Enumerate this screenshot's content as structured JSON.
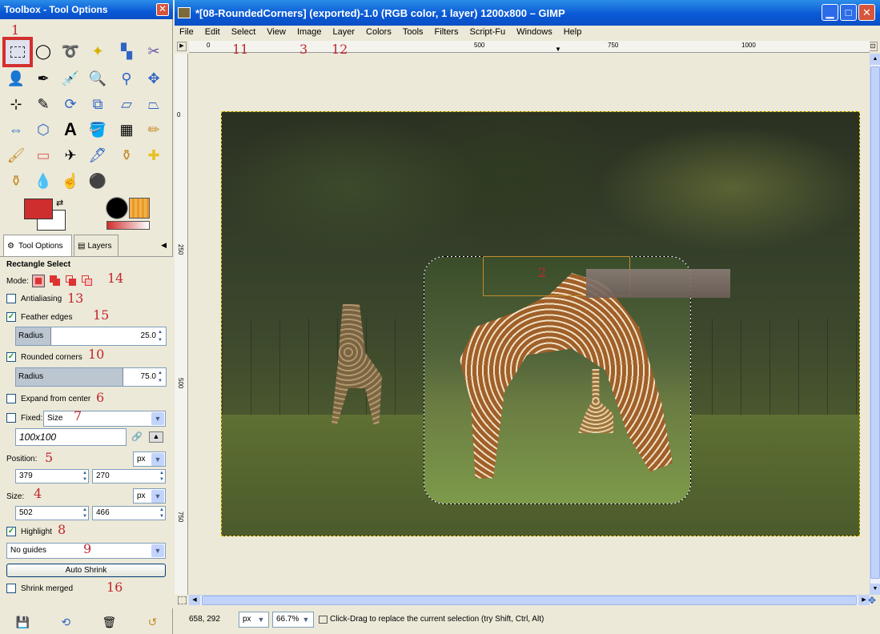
{
  "toolbox": {
    "title": "Toolbox - Tool Options",
    "tabs": [
      "Tool Options",
      "Layers"
    ],
    "tool_options": {
      "heading": "Rectangle Select",
      "mode_label": "Mode:",
      "antialiasing": {
        "label": "Antialiasing",
        "checked": false
      },
      "feather_edges": {
        "label": "Feather edges",
        "checked": true
      },
      "feather_radius": {
        "label": "Radius",
        "value": "25.0"
      },
      "rounded_corners": {
        "label": "Rounded corners",
        "checked": true
      },
      "rounded_radius": {
        "label": "Radius",
        "value": "75.0"
      },
      "expand_from_center": {
        "label": "Expand from center",
        "checked": false
      },
      "fixed": {
        "label": "Fixed:",
        "checked": false,
        "value": "Size"
      },
      "fixed_entry": "100x100",
      "position_label": "Position:",
      "position_unit": "px",
      "position_x": "379",
      "position_y": "270",
      "size_label": "Size:",
      "size_unit": "px",
      "size_w": "502",
      "size_h": "466",
      "highlight": {
        "label": "Highlight",
        "checked": true
      },
      "guides": "No guides",
      "auto_shrink": "Auto Shrink",
      "shrink_merged": {
        "label": "Shrink merged",
        "checked": false
      }
    }
  },
  "annotations": [
    "1",
    "2",
    "3",
    "4",
    "5",
    "6",
    "7",
    "8",
    "9",
    "10",
    "11",
    "12",
    "13",
    "14",
    "15",
    "16"
  ],
  "image_window": {
    "title": "*[08-RoundedCorners] (exported)-1.0 (RGB color, 1 layer) 1200x800 – GIMP",
    "menus": [
      "File",
      "Edit",
      "Select",
      "View",
      "Image",
      "Layer",
      "Colors",
      "Tools",
      "Filters",
      "Script-Fu",
      "Windows",
      "Help"
    ],
    "hruler_labels": [
      "0",
      "500",
      "750",
      "1000"
    ],
    "vruler_labels": [
      "0",
      "250",
      "500",
      "750"
    ],
    "status": {
      "coords": "658, 292",
      "unit": "px",
      "zoom": "66.7%",
      "message": "Click-Drag to replace the current selection (try Shift, Ctrl, Alt)"
    }
  }
}
